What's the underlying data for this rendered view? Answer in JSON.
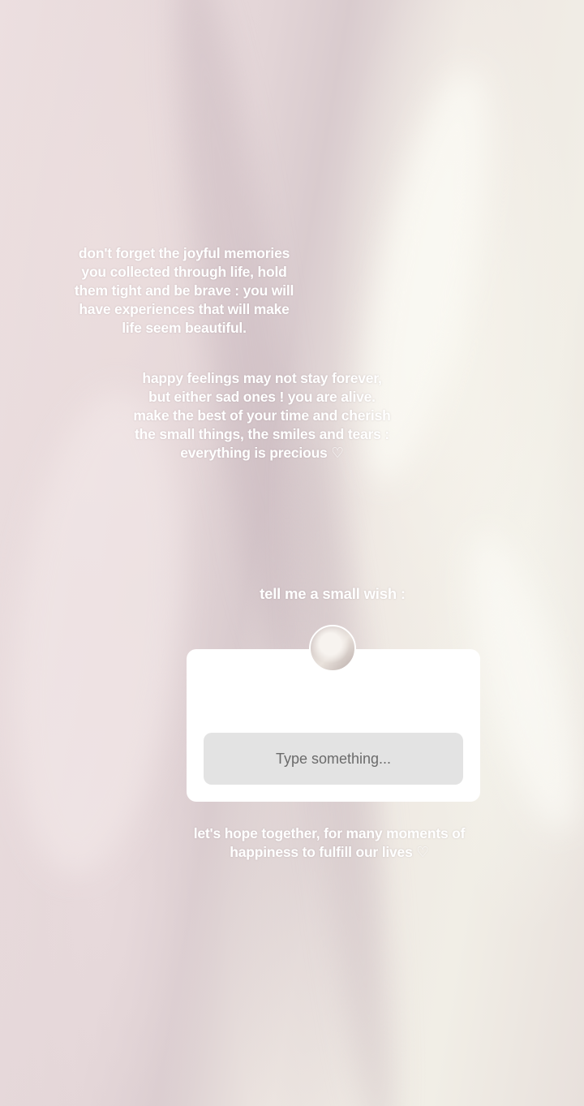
{
  "story": {
    "caption_1": "don't forget the joyful memories\nyou collected through life, hold\nthem tight and be brave : you will\nhave experiences that will make\nlife seem beautiful.",
    "caption_2": "happy feelings may not stay forever,\nbut either sad ones ! you are alive.\nmake the best of your time and cherish\nthe small things, the smiles and tears :\neverything is precious ♡",
    "question_prompt": "tell me a small wish :",
    "caption_3": "let's hope together, for many moments of\nhappiness to fulfill our lives ♡"
  },
  "question_sticker": {
    "input_placeholder": "Type something..."
  }
}
